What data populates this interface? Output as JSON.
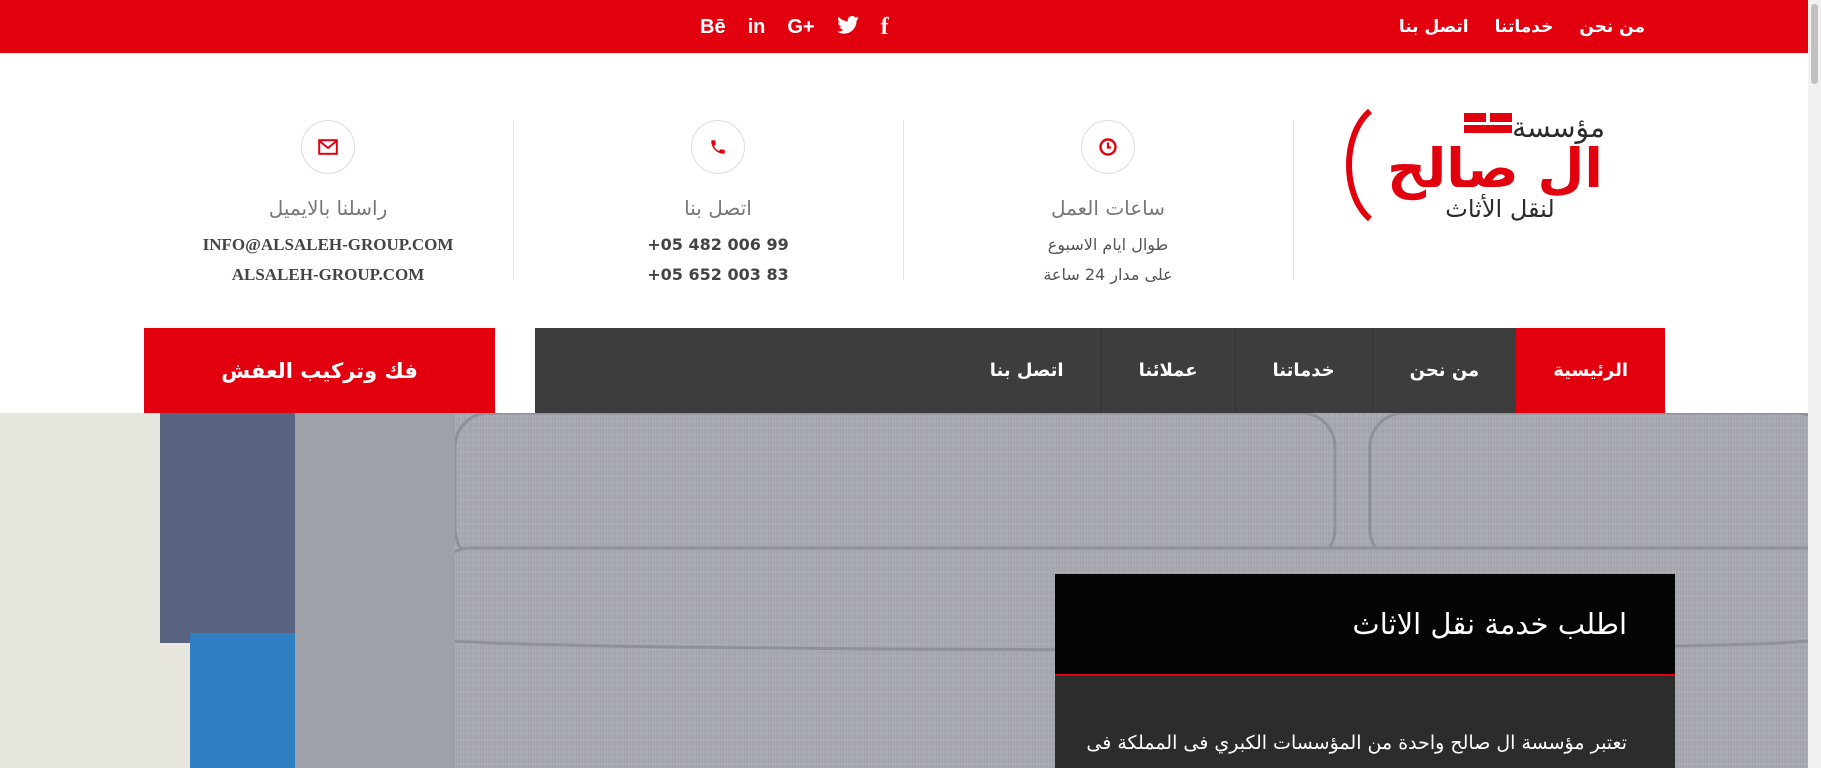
{
  "top_bar": {
    "nav": [
      "من نحن",
      "خدماتنا",
      "اتصل بنا"
    ],
    "social": [
      {
        "icon": "facebook-icon",
        "glyph": "f"
      },
      {
        "icon": "twitter-icon",
        "glyph": ""
      },
      {
        "icon": "google-plus-icon",
        "glyph": "G+"
      },
      {
        "icon": "linkedin-icon",
        "glyph": "in"
      },
      {
        "icon": "behance-icon",
        "glyph": "Bē"
      }
    ]
  },
  "logo": {
    "line1": "مؤسسة",
    "line2": "ال صالح",
    "line3": "لنقل الأثاث"
  },
  "info": {
    "hours": {
      "title": "ساعات العمل",
      "line1": "طوال ايام الاسبوع",
      "line2": "على مدار 24 ساعة"
    },
    "phone": {
      "title": "اتصل بنا",
      "line1": "+05 482 006 99",
      "line2": "+05 652 003 83"
    },
    "email": {
      "title": "راسلنا بالايميل",
      "line1": "INFO@ALSALEH-GROUP.COM",
      "line2": "ALSALEH-GROUP.COM"
    }
  },
  "main_nav": [
    "الرئيسية",
    "من نحن",
    "خدماتنا",
    "عملائنا",
    "اتصل بنا"
  ],
  "cta_label": "فك وتركيب العفش",
  "hero": {
    "panel_title": "اطلب خدمة نقل الاثاث",
    "panel_text": "تعتبر مؤسسة ال صالح واحدة من المؤسسات الكبري فى المملكة فى"
  },
  "colors": {
    "accent": "#e2000f",
    "nav_bg": "#3d3d3d",
    "panel_head": "#050505"
  }
}
